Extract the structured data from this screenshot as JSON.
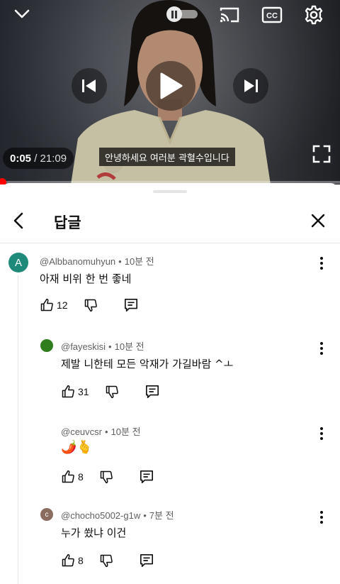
{
  "player": {
    "current_time": "0:05",
    "separator": " / ",
    "duration": "21:09",
    "caption": "안녕하세요 여러분 곽혈수입니다",
    "progress_fraction": 0.004,
    "cc_label": "CC"
  },
  "panel": {
    "title": "답글"
  },
  "comments": [
    {
      "avatar_letter": "A",
      "avatar_color": "#1f8a7a",
      "author": "@Albbanomuhyun",
      "time": "10분 전",
      "text": "아재 비위 한 번 좋네",
      "likes": "12"
    },
    {
      "avatar_letter": "",
      "avatar_color": "#2f7d1c",
      "author": "@fayeskisi",
      "time": "10분 전",
      "text": "제발 니한테 모든 악재가 가길바람 ^ㅗ",
      "likes": "31"
    },
    {
      "avatar_letter": "",
      "avatar_color": "#ffffff",
      "author": "@ceuvcsr",
      "time": "10분 전",
      "text": "🌶️🫰",
      "likes": "8"
    },
    {
      "avatar_letter": "c",
      "avatar_color": "#8a6d5e",
      "author": "@chocho5002-g1w",
      "time": "7분 전",
      "text": "누가 쐈냐 이건",
      "likes": "8"
    }
  ]
}
